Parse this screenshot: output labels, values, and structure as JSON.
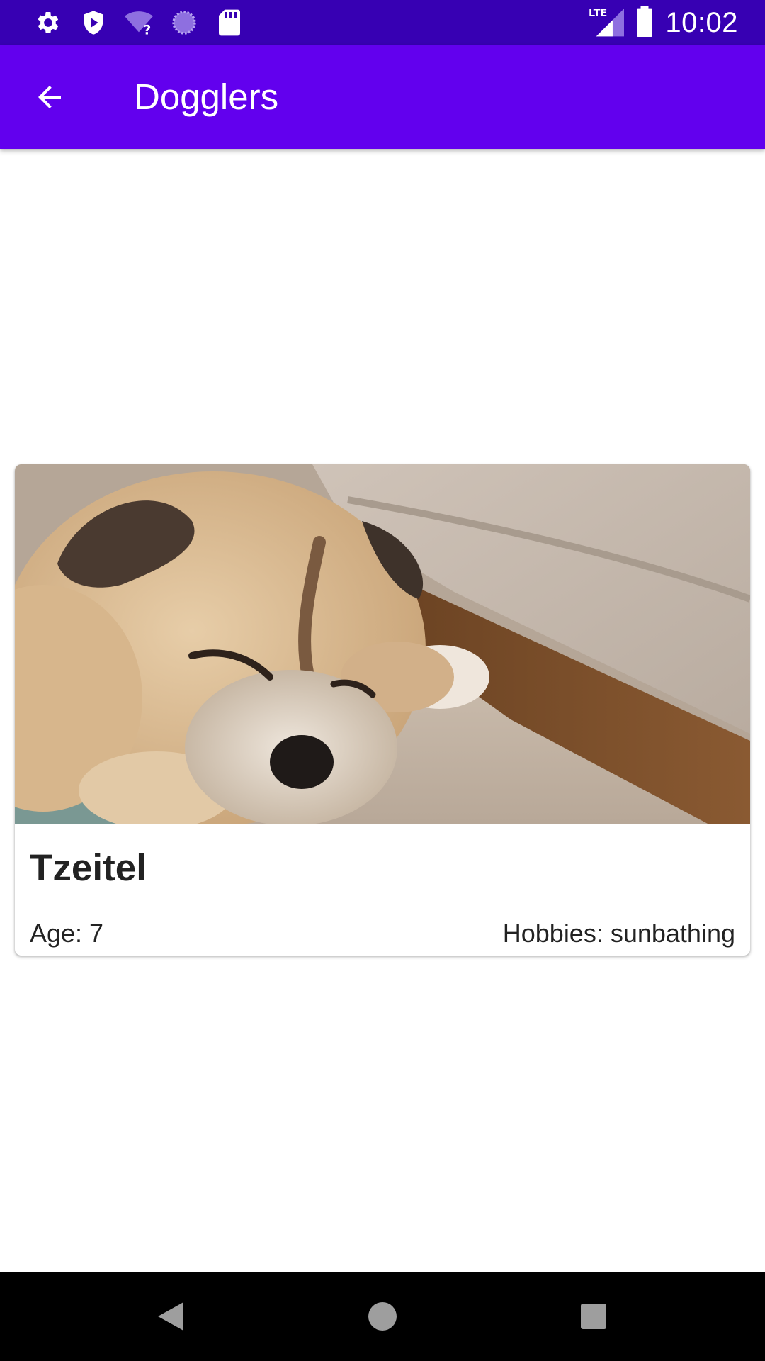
{
  "status_bar": {
    "time": "10:02",
    "icons": [
      "settings-icon",
      "shield-play-icon",
      "wifi-unknown-icon",
      "loading-icon",
      "sd-card-icon",
      "lte-signal-icon",
      "battery-icon"
    ],
    "network_label": "LTE"
  },
  "app_bar": {
    "title": "Dogglers",
    "back_icon": "arrow-back-icon"
  },
  "dog_card": {
    "name": "Tzeitel",
    "age": "Age: 7",
    "hobbies": "Hobbies: sunbathing"
  },
  "nav_bar": {
    "buttons": [
      "back-triangle-icon",
      "home-circle-icon",
      "recents-square-icon"
    ]
  },
  "colors": {
    "status_bar": "#3700b3",
    "app_bar": "#6200ee",
    "nav_bar": "#000000"
  }
}
